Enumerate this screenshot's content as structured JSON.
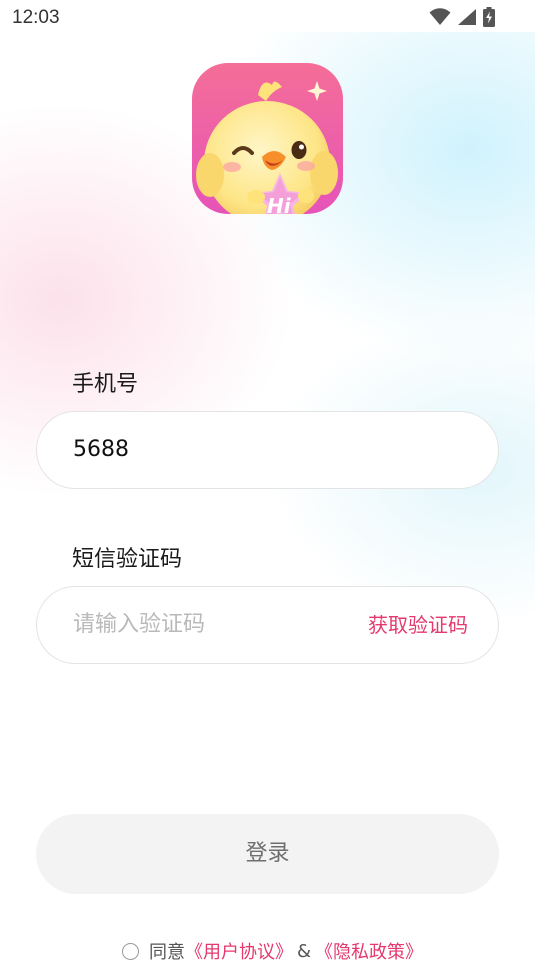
{
  "status_bar": {
    "time": "12:03",
    "icons": [
      "wifi-icon",
      "signal-icon",
      "battery-charging-icon"
    ]
  },
  "app": {
    "logo_icon": "chick-mascot-logo-icon",
    "logo_text": "Hi",
    "colors": {
      "accent": "#e5386e",
      "logo_background": "#f06aa8"
    }
  },
  "form": {
    "phone": {
      "label": "手机号",
      "value": "5688"
    },
    "sms_code": {
      "label": "短信验证码",
      "placeholder": "请输入验证码",
      "get_code_label": "获取验证码"
    }
  },
  "login_button": {
    "label": "登录"
  },
  "agreement": {
    "checked": false,
    "prefix": "同意",
    "user_agreement": "《用户协议》",
    "conjunction": "&",
    "privacy_policy": "《隐私政策》"
  }
}
